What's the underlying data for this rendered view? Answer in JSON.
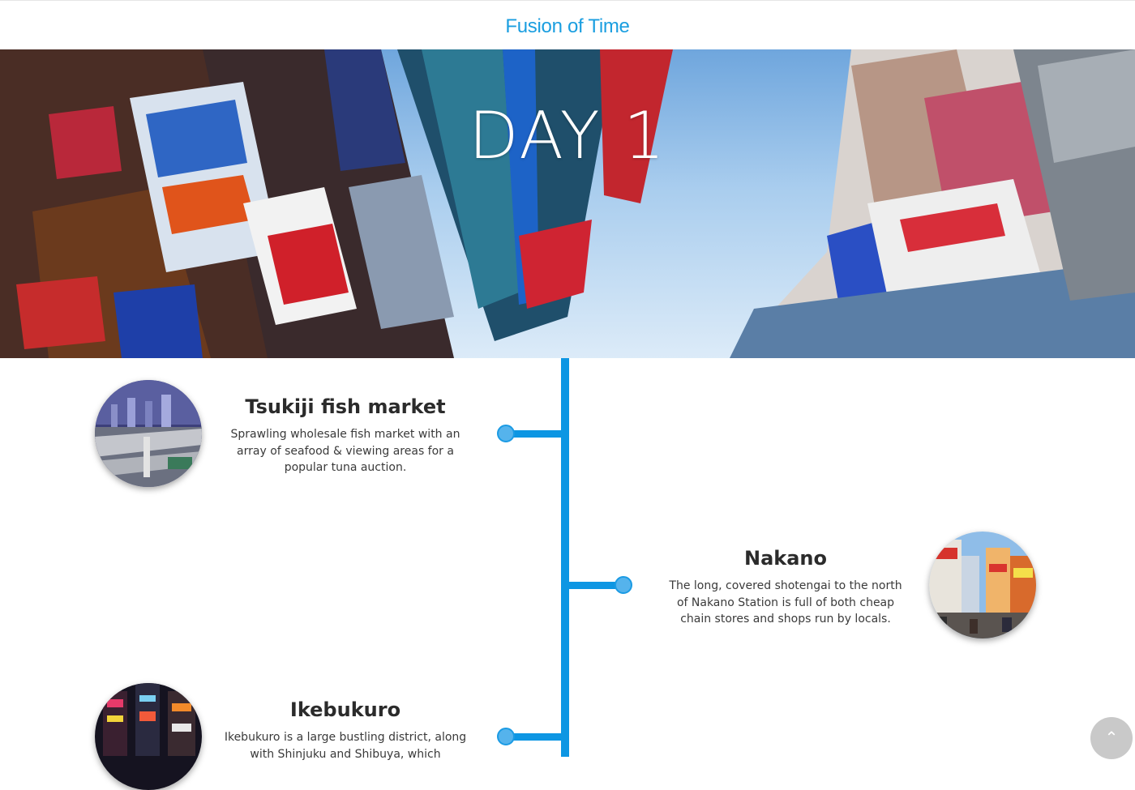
{
  "header": {
    "site_title": "Fusion of Time",
    "title_color": "#1a9ee0"
  },
  "hero": {
    "title": "DAY 1"
  },
  "timeline": {
    "accent_color": "#0d96e3",
    "entries": [
      {
        "title": "Tsukiji fish market",
        "description": "Sprawling wholesale fish market with an array of seafood & viewing areas for a popular tuna auction.",
        "side": "left"
      },
      {
        "title": "Nakano",
        "description": "The long, covered shotengai to the north of Nakano Station is full of both cheap chain stores and shops run by locals.",
        "side": "right"
      },
      {
        "title": "Ikebukuro",
        "description": "Ikebukuro is a large bustling district, along with Shinjuku and Shibuya, which",
        "side": "left"
      }
    ]
  },
  "scroll_top": {
    "icon": "chevron-up-icon",
    "glyph": "⌃"
  }
}
